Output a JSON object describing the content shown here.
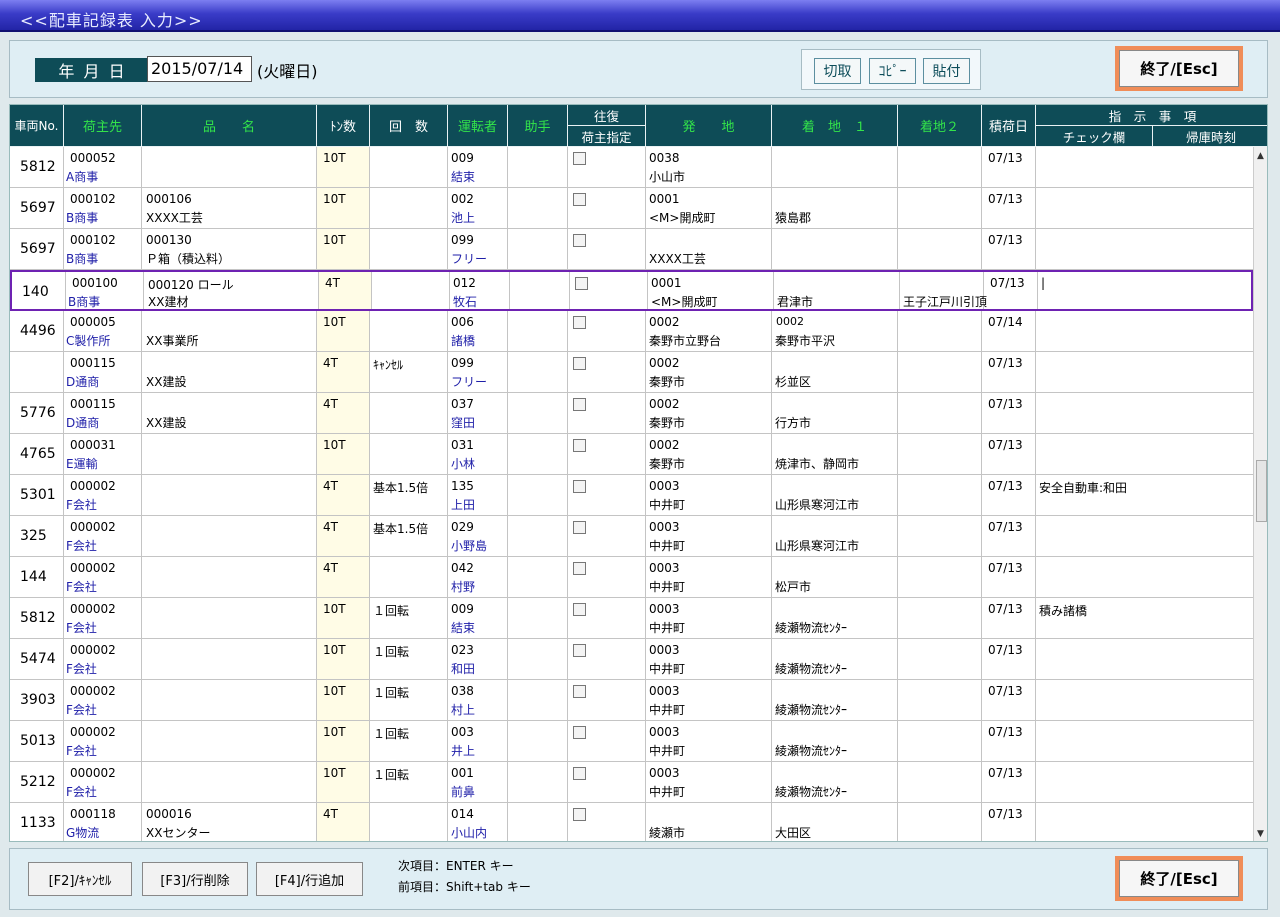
{
  "window": {
    "title": "<<配車記録表 入力>>"
  },
  "header": {
    "date_label": "年 月 日",
    "date_value": "2015/07/14",
    "weekday": "(火曜日)",
    "cut_label": "切取",
    "copy_label": "ｺﾋﾟｰ",
    "paste_label": "貼付",
    "end_label": "終了/[Esc]"
  },
  "columns": {
    "vehicle_no": "車両No.",
    "shipper": "荷主先",
    "item_name": "品　　名",
    "tonnage": "ﾄﾝ数",
    "count": "回　数",
    "driver": "運転者",
    "assistant": "助手",
    "round_trip": "往復",
    "shipper_designated": "荷主指定",
    "origin": "発　　地",
    "dest1": "着　地　１",
    "dest2": "着地２",
    "load_date": "積荷日",
    "instructions": "指　示　事　項",
    "check_column": "チェック欄",
    "return_time": "帰庫時刻"
  },
  "rows": [
    {
      "vehicle": "5812",
      "shipper_code": "000052",
      "shipper_name": "A商事",
      "item_code": "",
      "item_name": "",
      "ton": "10T",
      "count": "",
      "driver_code": "009",
      "driver_name": "結束",
      "origin_code": "0038",
      "origin_name": "小山市",
      "dest1_code": "",
      "dest1_name": "",
      "dest2": "",
      "load_date": "07/13",
      "note": ""
    },
    {
      "vehicle": "5697",
      "shipper_code": "000102",
      "shipper_name": "B商事",
      "item_code": "000106",
      "item_name": "XXXX工芸",
      "ton": "10T",
      "count": "",
      "driver_code": "002",
      "driver_name": "池上",
      "origin_code": "0001",
      "origin_name": "<M>開成町",
      "dest1_code": "",
      "dest1_name": "猿島郡",
      "dest2": "",
      "load_date": "07/13",
      "note": ""
    },
    {
      "vehicle": "5697",
      "shipper_code": "000102",
      "shipper_name": "B商事",
      "item_code": "000130",
      "item_name": "Ｐ箱（積込料）",
      "ton": "10T",
      "count": "",
      "driver_code": "099",
      "driver_name": "フリー",
      "origin_code": "",
      "origin_name": "XXXX工芸",
      "dest1_code": "",
      "dest1_name": "",
      "dest2": "",
      "load_date": "07/13",
      "note": ""
    },
    {
      "vehicle": "140",
      "shipper_code": "000100",
      "shipper_name": "B商事",
      "item_code": "000120 ロール",
      "item_name": "XX建材",
      "ton": "4T",
      "count": "",
      "driver_code": "012",
      "driver_name": "牧石",
      "origin_code": "0001",
      "origin_name": "<M>開成町",
      "dest1_code": "",
      "dest1_name": "君津市",
      "dest2": "王子江戸川引頂",
      "load_date": "07/13",
      "note": "|"
    },
    {
      "vehicle": "4496",
      "shipper_code": "000005",
      "shipper_name": "C製作所",
      "item_code": "",
      "item_name": "XX事業所",
      "ton": "10T",
      "count": "",
      "driver_code": "006",
      "driver_name": "諸橋",
      "origin_code": "0002",
      "origin_name": "秦野市立野台",
      "dest1_code": "0002",
      "dest1_name": "秦野市平沢",
      "dest2": "",
      "load_date": "07/14",
      "note": ""
    },
    {
      "vehicle": "",
      "shipper_code": "000115",
      "shipper_name": "D通商",
      "item_code": "",
      "item_name": "XX建設",
      "ton": "4T",
      "count": "ｷｬﾝｾﾙ",
      "driver_code": "099",
      "driver_name": "フリー",
      "origin_code": "0002",
      "origin_name": "秦野市",
      "dest1_code": "",
      "dest1_name": "杉並区",
      "dest2": "",
      "load_date": "07/13",
      "note": ""
    },
    {
      "vehicle": "5776",
      "shipper_code": "000115",
      "shipper_name": "D通商",
      "item_code": "",
      "item_name": "XX建設",
      "ton": "4T",
      "count": "",
      "driver_code": "037",
      "driver_name": "窪田",
      "origin_code": "0002",
      "origin_name": "秦野市",
      "dest1_code": "",
      "dest1_name": "行方市",
      "dest2": "",
      "load_date": "07/13",
      "note": ""
    },
    {
      "vehicle": "4765",
      "shipper_code": "000031",
      "shipper_name": "E運輸",
      "item_code": "",
      "item_name": "",
      "ton": "10T",
      "count": "",
      "driver_code": "031",
      "driver_name": "小林",
      "origin_code": "0002",
      "origin_name": "秦野市",
      "dest1_code": "",
      "dest1_name": "焼津市、静岡市",
      "dest2": "",
      "load_date": "07/13",
      "note": ""
    },
    {
      "vehicle": "5301",
      "shipper_code": "000002",
      "shipper_name": "F会社",
      "item_code": "",
      "item_name": "",
      "ton": "4T",
      "count": "基本1.5倍",
      "driver_code": "135",
      "driver_name": "上田",
      "origin_code": "0003",
      "origin_name": "中井町",
      "dest1_code": "",
      "dest1_name": "山形県寒河江市",
      "dest2": "",
      "load_date": "07/13",
      "note": "安全自動車:和田"
    },
    {
      "vehicle": "325",
      "shipper_code": "000002",
      "shipper_name": "F会社",
      "item_code": "",
      "item_name": "",
      "ton": "4T",
      "count": "基本1.5倍",
      "driver_code": "029",
      "driver_name": "小野島",
      "origin_code": "0003",
      "origin_name": "中井町",
      "dest1_code": "",
      "dest1_name": "山形県寒河江市",
      "dest2": "",
      "load_date": "07/13",
      "note": ""
    },
    {
      "vehicle": "144",
      "shipper_code": "000002",
      "shipper_name": "F会社",
      "item_code": "",
      "item_name": "",
      "ton": "4T",
      "count": "",
      "driver_code": "042",
      "driver_name": "村野",
      "origin_code": "0003",
      "origin_name": "中井町",
      "dest1_code": "",
      "dest1_name": "松戸市",
      "dest2": "",
      "load_date": "07/13",
      "note": ""
    },
    {
      "vehicle": "5812",
      "shipper_code": "000002",
      "shipper_name": "F会社",
      "item_code": "",
      "item_name": "",
      "ton": "10T",
      "count": "１回転",
      "driver_code": "009",
      "driver_name": "結束",
      "origin_code": "0003",
      "origin_name": "中井町",
      "dest1_code": "",
      "dest1_name": "綾瀬物流ｾﾝﾀｰ",
      "dest2": "",
      "load_date": "07/13",
      "note": "積み諸橋"
    },
    {
      "vehicle": "5474",
      "shipper_code": "000002",
      "shipper_name": "F会社",
      "item_code": "",
      "item_name": "",
      "ton": "10T",
      "count": "１回転",
      "driver_code": "023",
      "driver_name": "和田",
      "origin_code": "0003",
      "origin_name": "中井町",
      "dest1_code": "",
      "dest1_name": "綾瀬物流ｾﾝﾀｰ",
      "dest2": "",
      "load_date": "07/13",
      "note": ""
    },
    {
      "vehicle": "3903",
      "shipper_code": "000002",
      "shipper_name": "F会社",
      "item_code": "",
      "item_name": "",
      "ton": "10T",
      "count": "１回転",
      "driver_code": "038",
      "driver_name": "村上",
      "origin_code": "0003",
      "origin_name": "中井町",
      "dest1_code": "",
      "dest1_name": "綾瀬物流ｾﾝﾀｰ",
      "dest2": "",
      "load_date": "07/13",
      "note": ""
    },
    {
      "vehicle": "5013",
      "shipper_code": "000002",
      "shipper_name": "F会社",
      "item_code": "",
      "item_name": "",
      "ton": "10T",
      "count": "１回転",
      "driver_code": "003",
      "driver_name": "井上",
      "origin_code": "0003",
      "origin_name": "中井町",
      "dest1_code": "",
      "dest1_name": "綾瀬物流ｾﾝﾀｰ",
      "dest2": "",
      "load_date": "07/13",
      "note": ""
    },
    {
      "vehicle": "5212",
      "shipper_code": "000002",
      "shipper_name": "F会社",
      "item_code": "",
      "item_name": "",
      "ton": "10T",
      "count": "１回転",
      "driver_code": "001",
      "driver_name": "前鼻",
      "origin_code": "0003",
      "origin_name": "中井町",
      "dest1_code": "",
      "dest1_name": "綾瀬物流ｾﾝﾀｰ",
      "dest2": "",
      "load_date": "07/13",
      "note": ""
    },
    {
      "vehicle": "1133",
      "shipper_code": "000118",
      "shipper_name": "G物流",
      "item_code": "000016",
      "item_name": "XXセンター",
      "ton": "4T",
      "count": "",
      "driver_code": "014",
      "driver_name": "小山内",
      "origin_code": "",
      "origin_name": "綾瀬市",
      "dest1_code": "",
      "dest1_name": "大田区",
      "dest2": "",
      "load_date": "07/13",
      "note": ""
    }
  ],
  "selected_row": 3,
  "footer": {
    "f2_label": "[F2]/ｷｬﾝｾﾙ",
    "f3_label": "[F3]/行削除",
    "f4_label": "[F4]/行追加",
    "help_next": "次項目：ENTER キー",
    "help_prev": "前項目：Shift+tab キー",
    "end_label": "終了/[Esc]"
  },
  "colors": {
    "header_bg": "#0e4c57",
    "header_green": "#33e44a",
    "selected_border": "#6e22b2",
    "end_border": "#f08d58"
  }
}
